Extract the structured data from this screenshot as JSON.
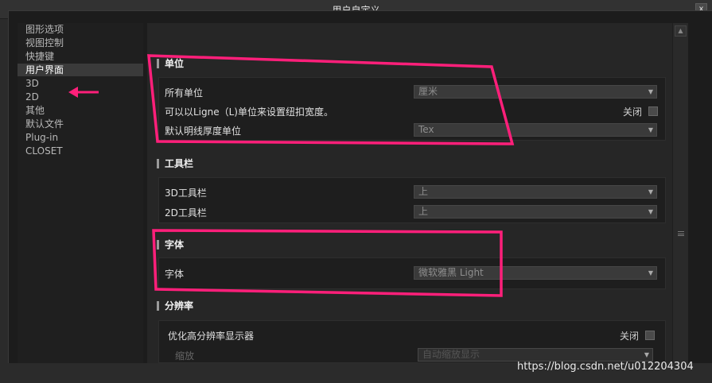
{
  "window": {
    "title": "用户自定义",
    "close_glyph": "x"
  },
  "nav": {
    "items": [
      {
        "label": "图形选项"
      },
      {
        "label": "视图控制"
      },
      {
        "label": "快捷键"
      },
      {
        "label": "用户界面",
        "active": true
      },
      {
        "label": "3D"
      },
      {
        "label": "2D"
      },
      {
        "label": "其他"
      },
      {
        "label": "默认文件"
      },
      {
        "label": "Plug-in"
      },
      {
        "label": "CLOSET"
      }
    ]
  },
  "sections": {
    "units": {
      "title": "单位",
      "all_units_label": "所有单位",
      "all_units_value": "厘米",
      "ligne_label": "可以以Ligne（L)单位来设置纽扣宽度。",
      "ligne_toggle_label": "关闭",
      "thread_label": "默认明线厚度单位",
      "thread_value": "Tex"
    },
    "toolbar": {
      "title": "工具栏",
      "toolbar3d_label": "3D工具栏",
      "toolbar3d_value": "上",
      "toolbar2d_label": "2D工具栏",
      "toolbar2d_value": "上"
    },
    "font": {
      "title": "字体",
      "font_label": "字体",
      "font_value": "微软雅黑 Light"
    },
    "resolution": {
      "title": "分辨率",
      "hidpi_label": "优化高分辨率显示器",
      "hidpi_toggle_label": "关闭",
      "zoom_label": "缩放",
      "zoom_value": "自动缩放显示"
    }
  },
  "annotations": {
    "color": "#ff1f7a"
  },
  "watermark": "https://blog.csdn.net/u012204304"
}
